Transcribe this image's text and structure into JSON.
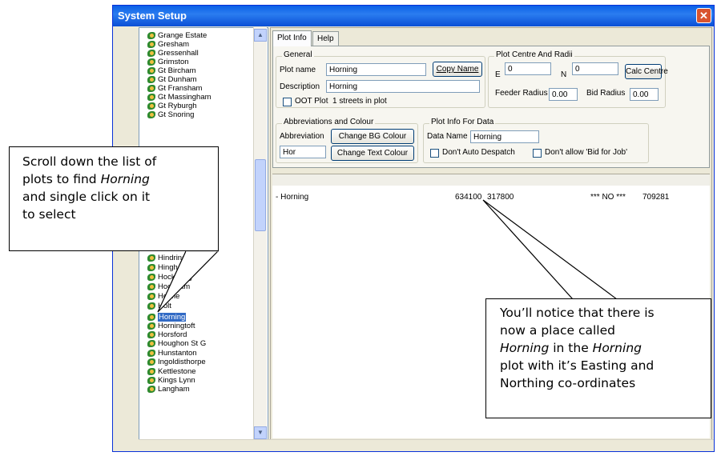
{
  "window": {
    "title": "System Setup",
    "close_glyph": "✕"
  },
  "tree": {
    "items": [
      "Grange Estate",
      "Gresham",
      "Gressenhall",
      "Grimston",
      "Gt Bircham",
      "Gt Dunham",
      "Gt Fransham",
      "Gt Massingham",
      "Gt Ryburgh",
      "Gt Snoring",
      "Hindringham",
      "Hingham",
      "Hockering",
      "Hockham",
      "Holme",
      "Holt",
      "Horning",
      "Horningtoft",
      "Horsford",
      "Houghon St G",
      "Hunstanton",
      "Ingoldisthorpe",
      "Kettlestone",
      "Kings Lynn",
      "Langham"
    ],
    "selected": "Horning",
    "partial_upper": "t",
    "icon": "plot-icon"
  },
  "scroll": {
    "up_glyph": "▲",
    "down_glyph": "▼"
  },
  "tabs": [
    {
      "label": "Plot Info"
    },
    {
      "label": "Help"
    }
  ],
  "general": {
    "legend": "General",
    "plot_name_label": "Plot name",
    "plot_name_value": "Horning",
    "copy_name_button": "Copy Name",
    "description_label": "Description",
    "description_value": "Horning",
    "oot_plot_label": "OOT Plot",
    "streets_text": "1 streets in plot"
  },
  "centre": {
    "legend": "Plot Centre And Radii",
    "e_label": "E",
    "e_value": "0",
    "n_label": "N",
    "n_value": "0",
    "calc_button": "Calc Centre",
    "feeder_label": "Feeder Radius",
    "feeder_value": "0.00",
    "bid_label": "Bid Radius",
    "bid_value": "0.00"
  },
  "abbrev": {
    "legend": "Abbreviations and Colour",
    "abbreviation_label": "Abbreviation",
    "abbreviation_value": "Hor",
    "bg_button": "Change BG Colour",
    "text_button": "Change Text Colour"
  },
  "plotdata": {
    "legend": "Plot Info For Data",
    "data_name_label": "Data Name",
    "data_name_value": "Horning",
    "auto_despatch_label": "Don't Auto Despatch",
    "bid_for_job_label": "Don't allow 'Bid for Job'"
  },
  "list_row": {
    "name": "- Horning",
    "easting": "634100",
    "northing": "317800",
    "flag": "*** NO ***",
    "id": "709281"
  },
  "callouts": {
    "left": [
      "Scroll down the list of",
      "plots to find ",
      "Horning",
      "and single click on it",
      "to select"
    ],
    "right": [
      "You’ll notice that there is",
      "now a place called",
      "Horning",
      " in the ",
      "Horning",
      "plot with it’s Easting and",
      "Northing co-ordinates"
    ]
  }
}
